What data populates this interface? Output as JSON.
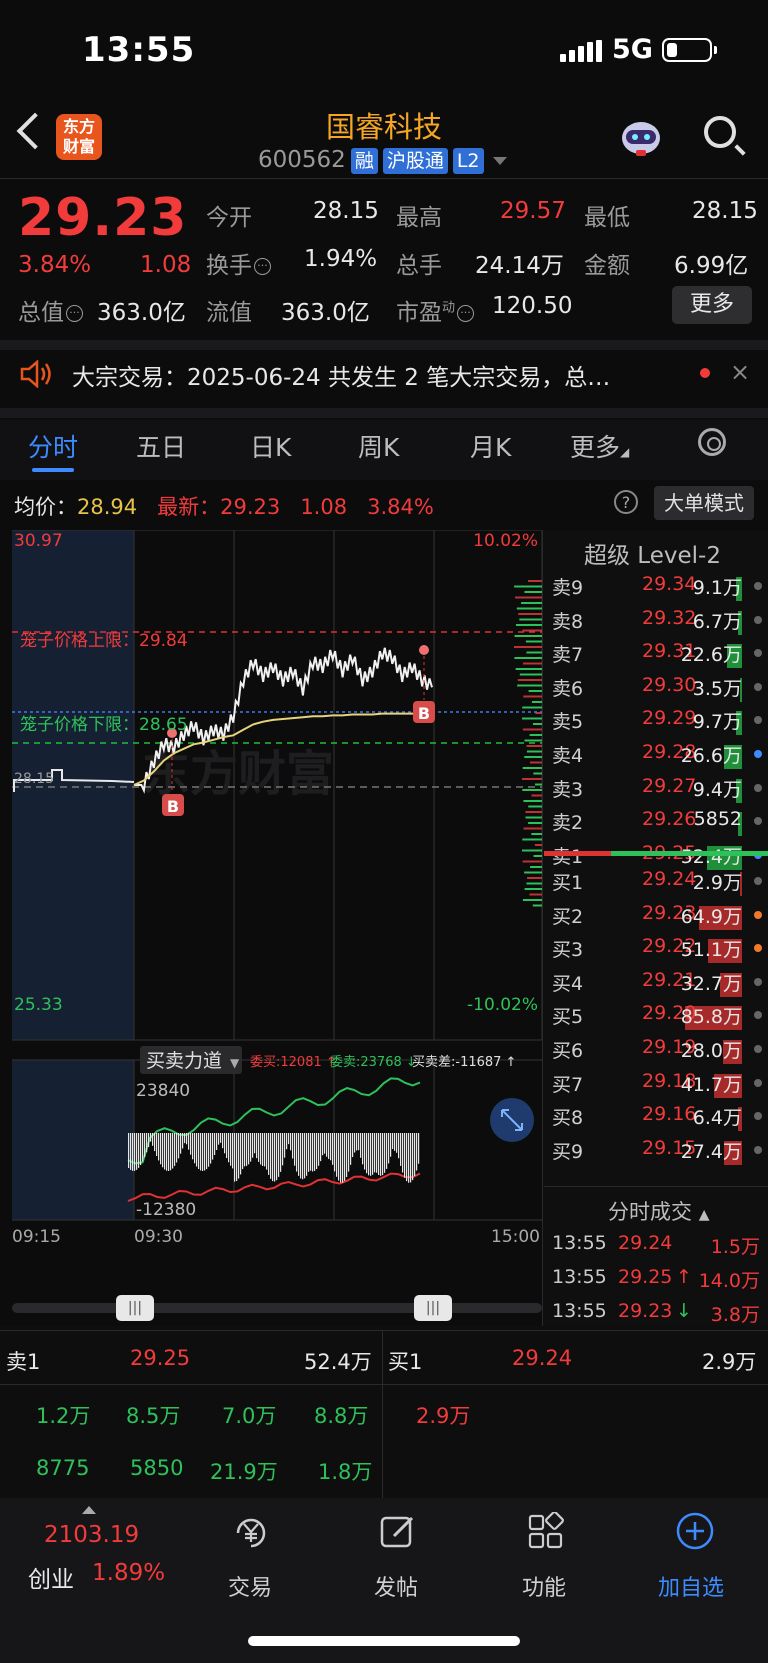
{
  "status_bar": {
    "time": "13:55",
    "network": "5G"
  },
  "header": {
    "logo_line1": "东方",
    "logo_line2": "财富",
    "stock_name": "国睿科技",
    "code": "600562",
    "tags": [
      "融",
      "沪股通",
      "L2"
    ]
  },
  "quote": {
    "price": "29.23",
    "change_pct": "3.84%",
    "change": "1.08",
    "open_label": "今开",
    "open": "28.15",
    "high_label": "最高",
    "high": "29.57",
    "low_label": "最低",
    "low": "28.15",
    "turnover_label": "换手",
    "turnover": "1.94%",
    "volume_label": "总手",
    "volume": "24.14万",
    "amount_label": "金额",
    "amount": "6.99亿",
    "mktcap_label": "总值",
    "mktcap": "363.0亿",
    "float_label": "流值",
    "float": "363.0亿",
    "pe_label": "市盈",
    "pe_sup": "动",
    "pe": "120.50",
    "more_label": "更多"
  },
  "news": {
    "text": "大宗交易：2025-06-24 共发生 2 笔大宗交易，总…",
    "close": "×"
  },
  "tabs": [
    "分时",
    "五日",
    "日K",
    "周K",
    "月K",
    "更多"
  ],
  "avg_bar": {
    "avg_label": "均价：",
    "avg": "28.94",
    "latest_label": "最新：",
    "latest": "29.23",
    "latest_chg": "1.08",
    "latest_pct": "3.84%",
    "help": "?",
    "mode_btn": "大单模式"
  },
  "chart_labels": {
    "top_left": "30.97",
    "top_right": "10.02%",
    "bottom_left": "25.33",
    "bottom_right": "-10.02%",
    "upper_limit": "笼子价格上限：29.84",
    "lower_limit": "笼子价格下限：28.65",
    "ref": "28.15",
    "marker": "B",
    "watermark": "东方财富",
    "sub_title": "买卖力道",
    "sub_buy": "委买:12081 ↑",
    "sub_sell": "委卖:23768 ↓",
    "sub_diff": "买卖差:-11687 ↑",
    "sub_top": "23840",
    "sub_bottom": "-12380",
    "time_start": "09:15",
    "time_mid": "09:30",
    "time_end": "15:00"
  },
  "chart_data": {
    "type": "line",
    "x_start": "09:30",
    "x_end": "15:00",
    "ylim": [
      25.33,
      30.97
    ],
    "series": [
      {
        "name": "最新",
        "values": [
          28.15,
          28.15,
          28.4,
          28.6,
          28.55,
          28.7,
          28.8,
          28.65,
          28.75,
          28.7,
          28.9,
          29.3,
          29.5,
          29.35,
          29.45,
          29.3,
          29.4,
          29.2,
          29.5,
          29.45,
          29.6,
          29.4,
          29.55,
          29.3,
          29.4,
          29.6,
          29.55,
          29.35,
          29.45,
          29.3,
          29.23
        ]
      },
      {
        "name": "均价",
        "values": [
          28.15,
          28.2,
          28.3,
          28.42,
          28.5,
          28.55,
          28.6,
          28.62,
          28.65,
          28.68,
          28.7,
          28.76,
          28.82,
          28.85,
          28.87,
          28.88,
          28.89,
          28.9,
          28.91,
          28.91,
          28.92,
          28.92,
          28.93,
          28.93,
          28.93,
          28.94,
          28.94,
          28.94,
          28.94,
          28.94,
          28.94
        ]
      }
    ]
  },
  "order_book": {
    "title": "超级 Level-2",
    "sell": [
      {
        "name": "卖9",
        "price": "29.34",
        "vol": "9.1万",
        "dot": "#666"
      },
      {
        "name": "卖8",
        "price": "29.32",
        "vol": "6.7万",
        "dot": "#666"
      },
      {
        "name": "卖7",
        "price": "29.31",
        "vol": "22.6万",
        "dot": "#666"
      },
      {
        "name": "卖6",
        "price": "29.30",
        "vol": "3.5万",
        "dot": "#666"
      },
      {
        "name": "卖5",
        "price": "29.29",
        "vol": "9.7万",
        "dot": "#666"
      },
      {
        "name": "卖4",
        "price": "29.28",
        "vol": "26.6万",
        "dot": "#3d8bff"
      },
      {
        "name": "卖3",
        "price": "29.27",
        "vol": "9.4万",
        "dot": "#666"
      },
      {
        "name": "卖2",
        "price": "29.26",
        "vol": "5852",
        "dot": "#666"
      },
      {
        "name": "卖1",
        "price": "29.25",
        "vol": "52.4万",
        "dot": "#3d8bff"
      }
    ],
    "buy": [
      {
        "name": "买1",
        "price": "29.24",
        "vol": "2.9万",
        "dot": "#666"
      },
      {
        "name": "买2",
        "price": "29.23",
        "vol": "64.9万",
        "dot": "#f07a2a"
      },
      {
        "name": "买3",
        "price": "29.22",
        "vol": "51.1万",
        "dot": "#f07a2a"
      },
      {
        "name": "买4",
        "price": "29.21",
        "vol": "32.7万",
        "dot": "#666"
      },
      {
        "name": "买5",
        "price": "29.20",
        "vol": "85.8万",
        "dot": "#666"
      },
      {
        "name": "买6",
        "price": "29.19",
        "vol": "28.0万",
        "dot": "#666"
      },
      {
        "name": "买7",
        "price": "29.18",
        "vol": "41.7万",
        "dot": "#666"
      },
      {
        "name": "买8",
        "price": "29.16",
        "vol": "6.4万",
        "dot": "#666"
      },
      {
        "name": "买9",
        "price": "29.15",
        "vol": "27.4万",
        "dot": "#666"
      }
    ],
    "ticks_title": "分时成交",
    "ticks": [
      {
        "time": "13:55",
        "price": "29.24",
        "arrow": "",
        "vol": "1.5万"
      },
      {
        "time": "13:55",
        "price": "29.25",
        "arrow": "↑",
        "vol": "14.0万"
      },
      {
        "time": "13:55",
        "price": "29.23",
        "arrow": "↓",
        "vol": "3.8万"
      }
    ]
  },
  "bs_block": {
    "sell_label": "卖1",
    "sell_price": "29.25",
    "sell_vol": "52.4万",
    "buy_label": "买1",
    "buy_price": "29.24",
    "buy_vol": "2.9万",
    "sell_row1": [
      "1.2万",
      "8.5万",
      "7.0万",
      "8.8万"
    ],
    "sell_row2": [
      "8775",
      "5850",
      "21.9万",
      "1.8万"
    ],
    "buy_row1": [
      "2.9万"
    ]
  },
  "bottom_nav": {
    "index_value": "2103.19",
    "index_name": "创业",
    "index_pct": "1.89%",
    "items": [
      "交易",
      "发帖",
      "功能",
      "加自选"
    ]
  }
}
